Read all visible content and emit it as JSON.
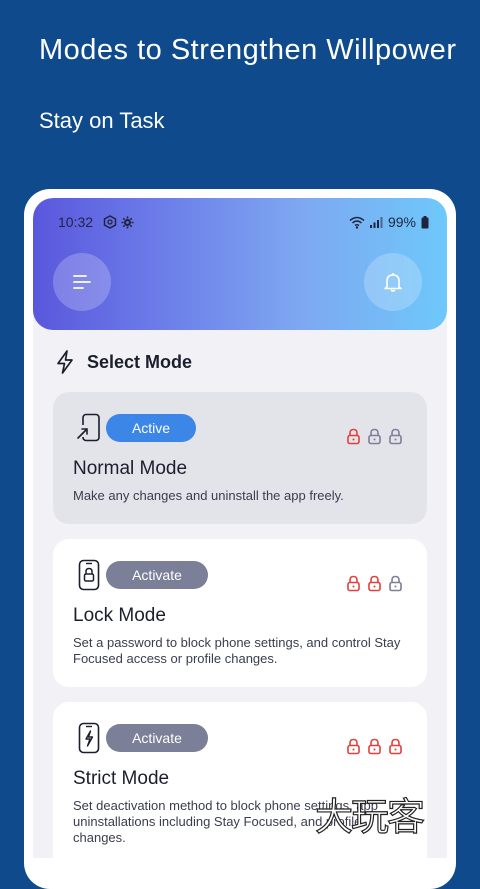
{
  "promo": {
    "title": "Modes to Strengthen Willpower",
    "subtitle": "Stay on Task"
  },
  "status_bar": {
    "time": "10:32",
    "battery": "99%"
  },
  "header": {
    "menu_icon": "menu-lines-icon",
    "bell_icon": "bell-icon"
  },
  "section": {
    "label": "Select Mode",
    "icon": "lightning-icon"
  },
  "modes": [
    {
      "name": "Normal Mode",
      "button": "Active",
      "description": "Make any changes and uninstall the app freely.",
      "icon": "phone-arrow-icon",
      "locks_active": 1
    },
    {
      "name": "Lock Mode",
      "button": "Activate",
      "description": "Set a password to block phone settings, and control Stay Focused access or profile changes.",
      "icon": "phone-lock-icon",
      "locks_active": 2
    },
    {
      "name": "Strict Mode",
      "button": "Activate",
      "description": "Set deactivation method to block phone settings, app uninstallations including Stay Focused, and profile changes.",
      "icon": "phone-bolt-icon",
      "locks_active": 3
    }
  ],
  "colors": {
    "background": "#0e4a8c",
    "active_pill": "#3b86e6",
    "inactive_pill": "#7b7f98",
    "lock_active": "#e0413b",
    "lock_inactive": "#7b7f98"
  },
  "watermark": "大玩客"
}
